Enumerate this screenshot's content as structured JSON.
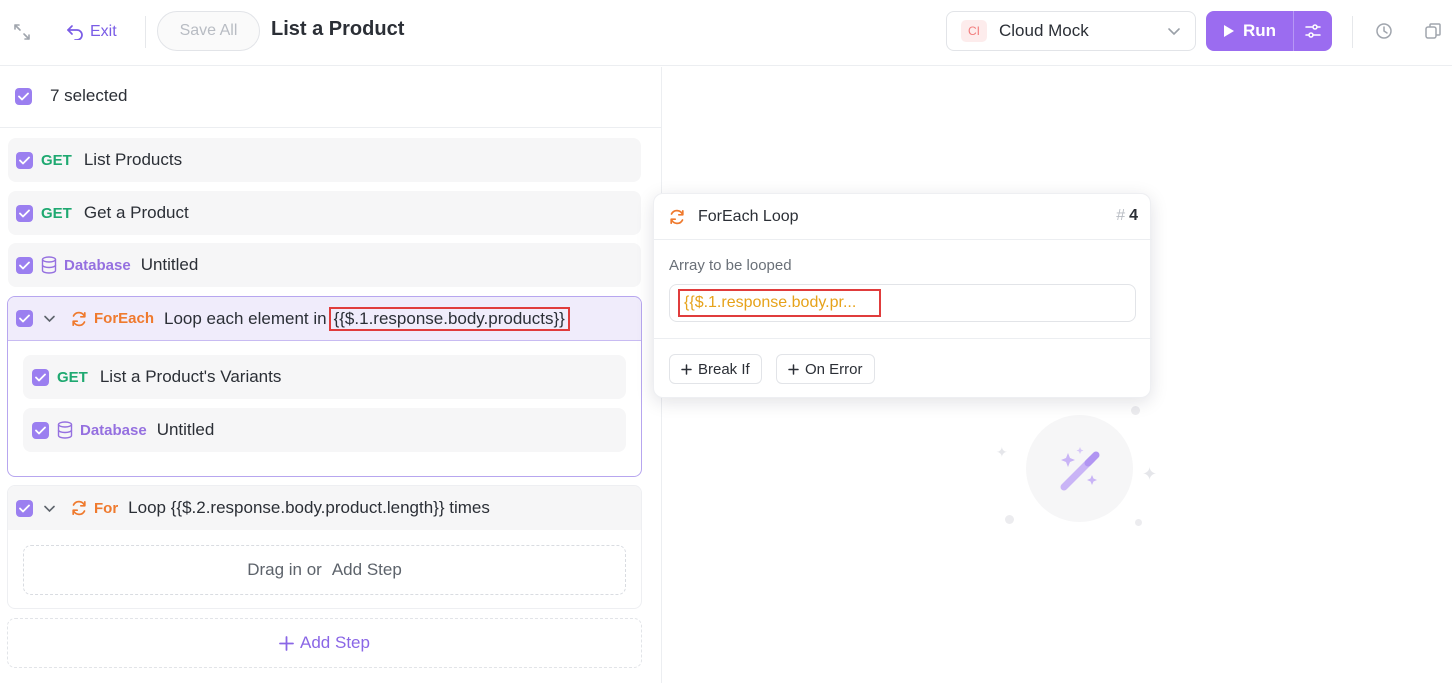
{
  "toolbar": {
    "exit_label": "Exit",
    "save_all_label": "Save All",
    "title": "List a Product",
    "environment": {
      "badge": "CI",
      "label": "Cloud Mock"
    },
    "run_label": "Run"
  },
  "selection": {
    "text": "7 selected"
  },
  "steps": [
    {
      "method": "GET",
      "title": "List Products"
    },
    {
      "method": "GET",
      "title": "Get a Product"
    },
    {
      "method": "Database",
      "title": "Untitled"
    }
  ],
  "foreach": {
    "method": "ForEach",
    "prefix": "Loop each element in",
    "expression": "{{$.1.response.body.products}}",
    "children": [
      {
        "method": "GET",
        "title": "List a Product's Variants"
      },
      {
        "method": "Database",
        "title": "Untitled"
      }
    ]
  },
  "for_loop": {
    "method": "For",
    "title": "Loop {{$.2.response.body.product.length}} times",
    "drop_text": "Drag in or",
    "add_step": "Add Step"
  },
  "add_step_label": "Add Step",
  "popover": {
    "title": "ForEach Loop",
    "number": "4",
    "array_label": "Array to be looped",
    "array_value": "{{$.1.response.body.pr...",
    "break_if": "Break If",
    "on_error": "On Error"
  },
  "colors": {
    "accent": "#9b6cf0",
    "get": "#1fa971",
    "database": "#9570e0",
    "loop": "#ef7a2e",
    "highlight": "#e03c3c",
    "expression_value": "#e6a21a"
  }
}
